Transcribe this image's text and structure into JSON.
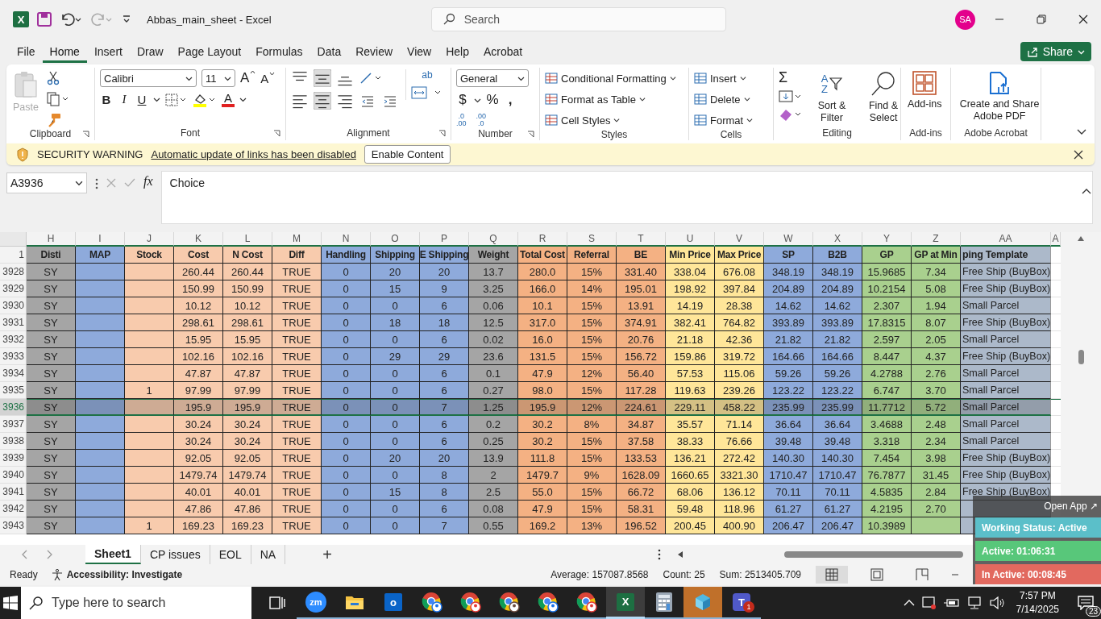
{
  "title_bar": {
    "app_letter": "X",
    "title": "Abbas_main_sheet  -  Excel",
    "search_placeholder": "Search",
    "avatar": "SA"
  },
  "menu": [
    {
      "label": "File",
      "selected": false
    },
    {
      "label": "Home",
      "selected": true
    },
    {
      "label": "Insert",
      "selected": false
    },
    {
      "label": "Draw",
      "selected": false
    },
    {
      "label": "Page Layout",
      "selected": false
    },
    {
      "label": "Formulas",
      "selected": false
    },
    {
      "label": "Data",
      "selected": false
    },
    {
      "label": "Review",
      "selected": false
    },
    {
      "label": "View",
      "selected": false
    },
    {
      "label": "Help",
      "selected": false
    },
    {
      "label": "Acrobat",
      "selected": false
    }
  ],
  "share": "Share",
  "ribbon": {
    "clipboard": {
      "label": "Clipboard",
      "paste": "Paste"
    },
    "font": {
      "label": "Font",
      "family": "Calibri",
      "size": "11",
      "grow": "A",
      "shrink": "A",
      "bold": "B",
      "italic": "I",
      "underline": "U",
      "color_letter": "A"
    },
    "alignment": {
      "label": "Alignment",
      "wrap": "ab",
      "vertical": [
        {
          "kind": "top",
          "selected": false
        },
        {
          "kind": "middle",
          "selected": true
        },
        {
          "kind": "bottom",
          "selected": false
        }
      ],
      "horizontal": [
        {
          "kind": "left",
          "selected": false
        },
        {
          "kind": "center",
          "selected": true
        },
        {
          "kind": "right",
          "selected": false
        }
      ]
    },
    "number": {
      "label": "Number",
      "format": "General",
      "currency": "$",
      "percent": "%",
      "comma": ",",
      "decimals": [
        {
          "top": ".0",
          "bottom": ".00"
        },
        {
          "top": ".00",
          "bottom": ".0"
        }
      ]
    },
    "styles": {
      "label": "Styles",
      "items": [
        "Conditional Formatting",
        "Format as Table",
        "Cell Styles"
      ]
    },
    "cells": {
      "label": "Cells",
      "items": [
        "Insert",
        "Delete",
        "Format"
      ]
    },
    "editing": {
      "label": "Editing",
      "autosum": "Σ",
      "sort_letters": [
        "A",
        "Z"
      ],
      "items": [
        "Sort & Filter",
        "Find & Select"
      ]
    },
    "addins": {
      "label": "Add-ins",
      "button": "Add-ins"
    },
    "acrobat": {
      "label": "Adobe Acrobat",
      "button": "Create and Share Adobe PDF"
    }
  },
  "security_bar": {
    "title": "SECURITY WARNING",
    "message": "Automatic update of links has been disabled",
    "button": "Enable Content"
  },
  "formula_bar": {
    "name_box": "A3936",
    "fx": "fx",
    "value": "Choice"
  },
  "sheet": {
    "header_row_number": "1",
    "extra_column_letter": "A",
    "columns": [
      {
        "letter": "H",
        "header": "Disti",
        "color": "#a5a5a5"
      },
      {
        "letter": "I",
        "header": "MAP",
        "color": "#8eaadb"
      },
      {
        "letter": "J",
        "header": "Stock",
        "color": "#f8cbad"
      },
      {
        "letter": "K",
        "header": "Cost",
        "color": "#f8cbad"
      },
      {
        "letter": "L",
        "header": "N Cost",
        "color": "#f8cbad"
      },
      {
        "letter": "M",
        "header": "Diff",
        "color": "#f8cbad"
      },
      {
        "letter": "N",
        "header": "Handling",
        "color": "#8eaadb"
      },
      {
        "letter": "O",
        "header": "Shipping",
        "color": "#8eaadb"
      },
      {
        "letter": "P",
        "header": "E Shipping",
        "color": "#8eaadb"
      },
      {
        "letter": "Q",
        "header": "Weight",
        "color": "#a5a5a5"
      },
      {
        "letter": "R",
        "header": "Total Cost",
        "color": "#f4b183"
      },
      {
        "letter": "S",
        "header": "Referral",
        "color": "#f4b183"
      },
      {
        "letter": "T",
        "header": "BE",
        "color": "#f4b183"
      },
      {
        "letter": "U",
        "header": "Min Price",
        "color": "#ffe699"
      },
      {
        "letter": "V",
        "header": "Max Price",
        "color": "#ffe699"
      },
      {
        "letter": "W",
        "header": "SP",
        "color": "#8eaadb"
      },
      {
        "letter": "X",
        "header": "B2B",
        "color": "#8eaadb"
      },
      {
        "letter": "Y",
        "header": "GP",
        "color": "#a9d08e"
      },
      {
        "letter": "Z",
        "header": "GP at Min",
        "color": "#a9d08e"
      },
      {
        "letter": "AA",
        "header": "ping Template",
        "color": "#acb9ca"
      }
    ],
    "rows": [
      {
        "num": "3928",
        "selected": false,
        "cells": [
          "SY",
          null,
          null,
          "260.44",
          "260.44",
          "TRUE",
          "0",
          "20",
          "20",
          "13.7",
          "280.0",
          "15%",
          "331.40",
          "338.04",
          "676.08",
          "348.19",
          "348.19",
          "15.9685",
          "7.34",
          "Free Ship (BuyBox)"
        ]
      },
      {
        "num": "3929",
        "selected": false,
        "cells": [
          "SY",
          null,
          null,
          "150.99",
          "150.99",
          "TRUE",
          "0",
          "15",
          "9",
          "3.25",
          "166.0",
          "14%",
          "195.01",
          "198.92",
          "397.84",
          "204.89",
          "204.89",
          "10.2154",
          "5.08",
          "Free Ship (BuyBox)"
        ]
      },
      {
        "num": "3930",
        "selected": false,
        "cells": [
          "SY",
          null,
          null,
          "10.12",
          "10.12",
          "TRUE",
          "0",
          "0",
          "6",
          "0.06",
          "10.1",
          "15%",
          "13.91",
          "14.19",
          "28.38",
          "14.62",
          "14.62",
          "2.307",
          "1.94",
          "Small Parcel"
        ]
      },
      {
        "num": "3931",
        "selected": false,
        "cells": [
          "SY",
          null,
          null,
          "298.61",
          "298.61",
          "TRUE",
          "0",
          "18",
          "18",
          "12.5",
          "317.0",
          "15%",
          "374.91",
          "382.41",
          "764.82",
          "393.89",
          "393.89",
          "17.8315",
          "8.07",
          "Free Ship (BuyBox)"
        ]
      },
      {
        "num": "3932",
        "selected": false,
        "cells": [
          "SY",
          null,
          null,
          "15.95",
          "15.95",
          "TRUE",
          "0",
          "0",
          "6",
          "0.02",
          "16.0",
          "15%",
          "20.76",
          "21.18",
          "42.36",
          "21.82",
          "21.82",
          "2.597",
          "2.05",
          "Small Parcel"
        ]
      },
      {
        "num": "3933",
        "selected": false,
        "cells": [
          "SY",
          null,
          null,
          "102.16",
          "102.16",
          "TRUE",
          "0",
          "29",
          "29",
          "23.6",
          "131.5",
          "15%",
          "156.72",
          "159.86",
          "319.72",
          "164.66",
          "164.66",
          "8.447",
          "4.37",
          "Free Ship (BuyBox)"
        ]
      },
      {
        "num": "3934",
        "selected": false,
        "cells": [
          "SY",
          null,
          null,
          "47.87",
          "47.87",
          "TRUE",
          "0",
          "0",
          "6",
          "0.1",
          "47.9",
          "12%",
          "56.40",
          "57.53",
          "115.06",
          "59.26",
          "59.26",
          "4.2788",
          "2.76",
          "Small Parcel"
        ]
      },
      {
        "num": "3935",
        "selected": false,
        "cells": [
          "SY",
          null,
          "1",
          "97.99",
          "97.99",
          "TRUE",
          "0",
          "0",
          "6",
          "0.27",
          "98.0",
          "15%",
          "117.28",
          "119.63",
          "239.26",
          "123.22",
          "123.22",
          "6.747",
          "3.70",
          "Small Parcel"
        ]
      },
      {
        "num": "3936",
        "selected": true,
        "cells": [
          "SY",
          null,
          null,
          "195.9",
          "195.9",
          "TRUE",
          "0",
          "0",
          "7",
          "1.25",
          "195.9",
          "12%",
          "224.61",
          "229.11",
          "458.22",
          "235.99",
          "235.99",
          "11.7712",
          "5.72",
          "Small Parcel"
        ]
      },
      {
        "num": "3937",
        "selected": false,
        "cells": [
          "SY",
          null,
          null,
          "30.24",
          "30.24",
          "TRUE",
          "0",
          "0",
          "6",
          "0.2",
          "30.2",
          "8%",
          "34.87",
          "35.57",
          "71.14",
          "36.64",
          "36.64",
          "3.4688",
          "2.48",
          "Small Parcel"
        ]
      },
      {
        "num": "3938",
        "selected": false,
        "cells": [
          "SY",
          null,
          null,
          "30.24",
          "30.24",
          "TRUE",
          "0",
          "0",
          "6",
          "0.25",
          "30.2",
          "15%",
          "37.58",
          "38.33",
          "76.66",
          "39.48",
          "39.48",
          "3.318",
          "2.34",
          "Small Parcel"
        ]
      },
      {
        "num": "3939",
        "selected": false,
        "cells": [
          "SY",
          null,
          null,
          "92.05",
          "92.05",
          "TRUE",
          "0",
          "20",
          "20",
          "13.9",
          "111.8",
          "15%",
          "133.53",
          "136.21",
          "272.42",
          "140.30",
          "140.30",
          "7.454",
          "3.98",
          "Free Ship (BuyBox)"
        ]
      },
      {
        "num": "3940",
        "selected": false,
        "cells": [
          "SY",
          null,
          null,
          "1479.74",
          "1479.74",
          "TRUE",
          "0",
          "0",
          "8",
          "2",
          "1479.7",
          "9%",
          "1628.09",
          "1660.65",
          "3321.30",
          "1710.47",
          "1710.47",
          "76.7877",
          "31.45",
          "Free Ship (BuyBox)"
        ]
      },
      {
        "num": "3941",
        "selected": false,
        "cells": [
          "SY",
          null,
          null,
          "40.01",
          "40.01",
          "TRUE",
          "0",
          "15",
          "8",
          "2.5",
          "55.0",
          "15%",
          "66.72",
          "68.06",
          "136.12",
          "70.11",
          "70.11",
          "4.5835",
          "2.84",
          "Free Ship (BuyBox)"
        ]
      },
      {
        "num": "3942",
        "selected": false,
        "cells": [
          "SY",
          null,
          null,
          "47.86",
          "47.86",
          "TRUE",
          "0",
          "0",
          "6",
          "0.08",
          "47.9",
          "15%",
          "58.31",
          "59.48",
          "118.96",
          "61.27",
          "61.27",
          "4.2195",
          "2.70",
          null
        ]
      },
      {
        "num": "3943",
        "selected": false,
        "cells": [
          "SY",
          null,
          "1",
          "169.23",
          "169.23",
          "TRUE",
          "0",
          "0",
          "7",
          "0.55",
          "169.2",
          "13%",
          "196.52",
          "200.45",
          "400.90",
          "206.47",
          "206.47",
          "10.3989",
          null,
          null
        ]
      }
    ]
  },
  "sheet_tabs": [
    {
      "label": "Sheet1",
      "selected": true
    },
    {
      "label": "CP issues",
      "selected": false
    },
    {
      "label": "EOL",
      "selected": false
    },
    {
      "label": "NA",
      "selected": false
    }
  ],
  "add_sheet": "+",
  "status_bar": {
    "mode": "Ready",
    "accessibility": "Accessibility: Investigate",
    "stats": [
      "Average: 157087.8568",
      "Count: 25",
      "Sum: 2513405.709"
    ],
    "views": [
      {
        "kind": "normal",
        "selected": true
      },
      {
        "kind": "layout",
        "selected": false
      },
      {
        "kind": "break",
        "selected": false
      }
    ]
  },
  "tracker": {
    "open_app": "Open App ↗",
    "rows": [
      {
        "kind": "status",
        "text": "Working Status: Active"
      },
      {
        "kind": "active",
        "text": "Active: 01:06:31"
      },
      {
        "kind": "inactive",
        "text": "In Active: 00:08:45"
      }
    ]
  },
  "taskbar": {
    "search_placeholder": "Type here to search",
    "apps": [
      {
        "kind": "taskview",
        "running": false,
        "selected": false,
        "highlighted": false
      },
      {
        "kind": "zoom",
        "label": "zm",
        "running": true,
        "selected": false,
        "highlighted": false
      },
      {
        "kind": "folder",
        "running": true,
        "selected": false,
        "highlighted": false
      },
      {
        "kind": "outlook",
        "label": "o",
        "running": true,
        "selected": false,
        "highlighted": false
      },
      {
        "kind": "chrome",
        "running": true,
        "selected": false,
        "highlighted": false
      },
      {
        "kind": "chrome",
        "running": true,
        "selected": false,
        "highlighted": false
      },
      {
        "kind": "chrome",
        "running": true,
        "selected": false,
        "highlighted": false
      },
      {
        "kind": "chrome",
        "running": true,
        "selected": false,
        "highlighted": false
      },
      {
        "kind": "chrome",
        "running": true,
        "selected": false,
        "highlighted": false
      },
      {
        "kind": "excel",
        "label": "X",
        "running": true,
        "selected": true,
        "highlighted": false
      },
      {
        "kind": "calculator",
        "running": true,
        "selected": false,
        "highlighted": false
      },
      {
        "kind": "app",
        "running": true,
        "selected": false,
        "highlighted": true
      },
      {
        "kind": "teams",
        "label": "T",
        "badge": "1",
        "running": true,
        "selected": false,
        "highlighted": false
      }
    ],
    "time": "7:57 PM",
    "date": "7/14/2025",
    "notifications": "23"
  }
}
